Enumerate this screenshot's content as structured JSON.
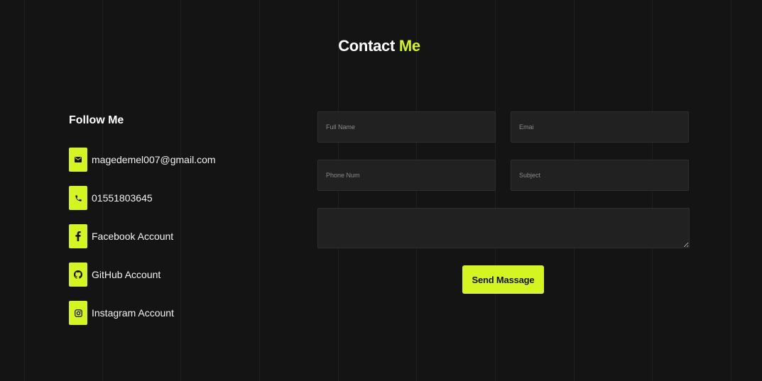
{
  "section": {
    "title_part1": "Contact",
    "title_part2": "Me",
    "accent_color": "#d4f51f",
    "background_color": "#141414"
  },
  "follow": {
    "heading": "Follow Me",
    "items": [
      {
        "icon": "envelope-icon",
        "label": "magedemel007@gmail.com"
      },
      {
        "icon": "phone-icon",
        "label": "01551803645"
      },
      {
        "icon": "facebook-icon",
        "label": "Facebook Account"
      },
      {
        "icon": "github-icon",
        "label": "GitHub Account"
      },
      {
        "icon": "instagram-icon",
        "label": "Instagram Account"
      }
    ]
  },
  "form": {
    "full_name_placeholder": "Full Name",
    "email_placeholder": "Emai",
    "phone_placeholder": "Phone Num",
    "subject_placeholder": "Subject",
    "message_value": "",
    "send_label": "Send Massage"
  }
}
